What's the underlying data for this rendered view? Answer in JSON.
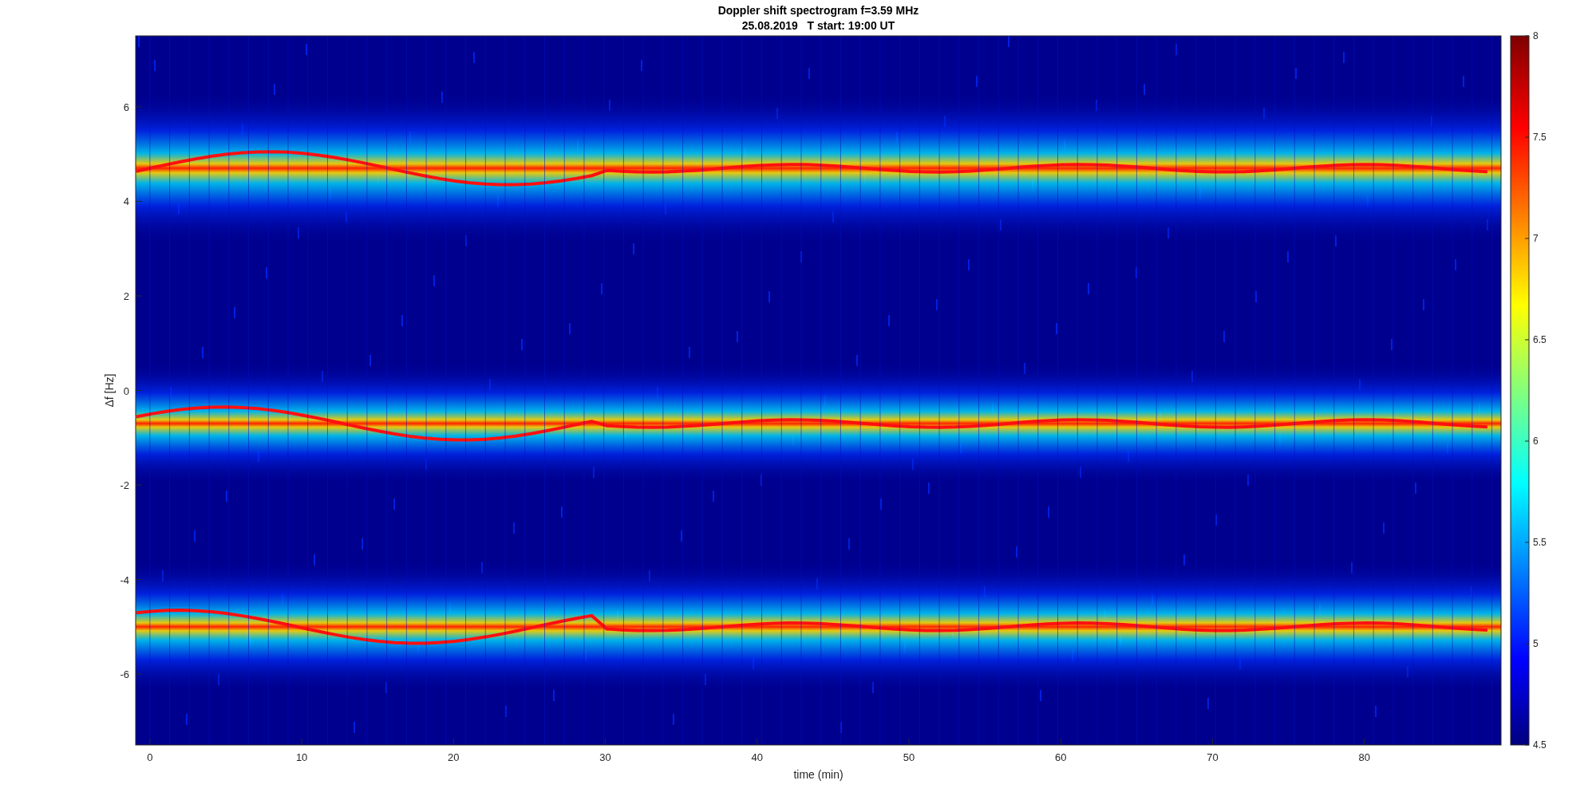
{
  "figure": {
    "title": [
      "Doppler shift spectrogram f=3.59 MHz",
      "25.08.2019   T start: 19:00 UT"
    ],
    "xlabel": "time (min)",
    "ylabel": "Δf [Hz]",
    "xticks": [
      "0",
      "10",
      "20",
      "30",
      "40",
      "50",
      "60",
      "70",
      "80"
    ],
    "yticks": [
      "6",
      "4",
      "2",
      "0",
      "-2",
      "-4",
      "-6"
    ],
    "colorbar_ticks": [
      "8",
      "7.5",
      "7",
      "6.5",
      "6",
      "5.5",
      "5",
      "4.5"
    ]
  }
}
